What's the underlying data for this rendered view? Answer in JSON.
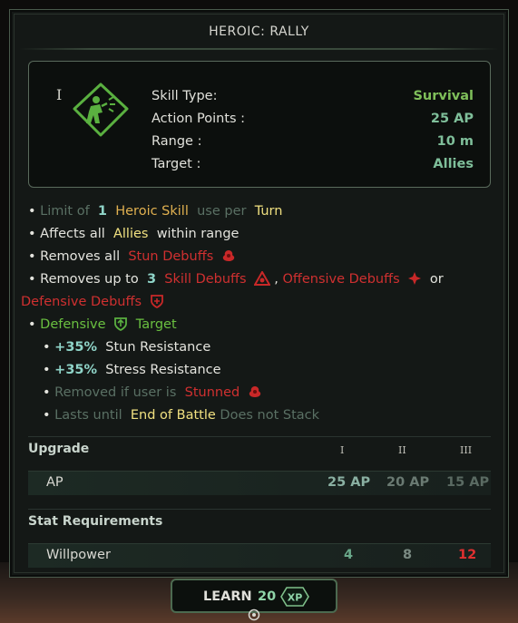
{
  "title": "HEROIC: RALLY",
  "tier_mark": "I",
  "info": {
    "skill_type_label": "Skill Type:",
    "skill_type_value": "Survival",
    "ap_label": "Action Points :",
    "ap_value": "25 AP",
    "range_label": "Range :",
    "range_value": "10 m",
    "target_label": "Target :",
    "target_value": "Allies"
  },
  "effects": {
    "l1": {
      "a": "Limit of",
      "b": "1",
      "c": "Heroic Skill",
      "d": "use per",
      "e": "Turn"
    },
    "l2": {
      "a": "Affects all",
      "b": "Allies",
      "c": "within range"
    },
    "l3": {
      "a": "Removes all",
      "b": "Stun Debuffs"
    },
    "l4": {
      "a": "Removes up to",
      "b": "3",
      "c": "Skill Debuffs",
      "d": ",",
      "e": "Offensive Debuffs",
      "f": "or"
    },
    "l5": {
      "a": "Defensive Debuffs"
    },
    "l6": {
      "a": "Defensive",
      "b": "Target"
    },
    "l7": {
      "a": "+35%",
      "b": "Stun Resistance"
    },
    "l8": {
      "a": "+35%",
      "b": "Stress Resistance"
    },
    "l9": {
      "a": "Removed if user is",
      "b": "Stunned"
    },
    "l10": {
      "a": "Lasts until",
      "b": "End of Battle",
      "c": "Does not Stack"
    }
  },
  "upgrade": {
    "header": "Upgrade",
    "tiers": [
      "I",
      "II",
      "III"
    ],
    "row_label": "AP",
    "values": [
      "25 AP",
      "20 AP",
      "15 AP"
    ]
  },
  "stat_requirements": {
    "header": "Stat Requirements",
    "row_label": "Willpower",
    "values": [
      "4",
      "8",
      "12"
    ]
  },
  "learn_button": {
    "label": "LEARN",
    "cost": "20",
    "currency": "XP"
  },
  "colors": {
    "accent_green": "#7fbf5a",
    "debuff_red": "#d03030",
    "gold": "#e0b050",
    "cyan_number": "#8fd4c8"
  }
}
